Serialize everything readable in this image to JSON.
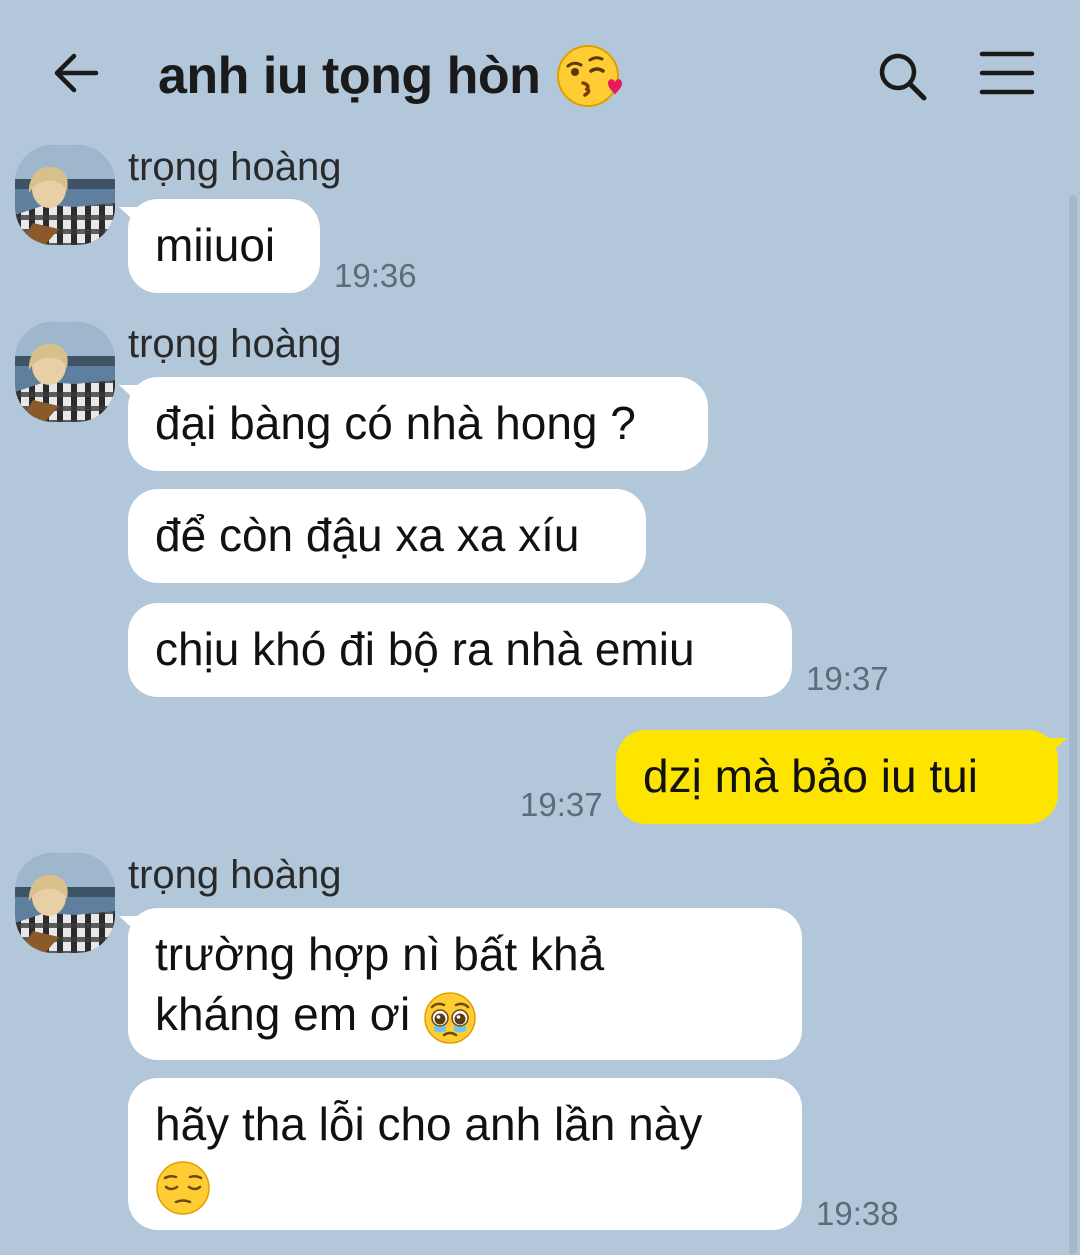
{
  "header": {
    "title": "anh iu tọng hòn",
    "title_emoji_icon": "face-blowing-kiss-icon",
    "back_icon": "arrow-left-icon",
    "search_icon": "search-icon",
    "menu_icon": "hamburger-menu-icon"
  },
  "colors": {
    "background": "#b2c7d9",
    "incoming_bubble": "#ffffff",
    "outgoing_bubble": "#fee500",
    "timestamp": "#5d6c79"
  },
  "messages": [
    {
      "sender": "trọng hoàng",
      "text": "miiuoi",
      "time": "19:36"
    },
    {
      "sender": "trọng hoàng",
      "text": "đại bàng có nhà hong ?"
    },
    {
      "text": "để còn đậu xa xa xíu"
    },
    {
      "text": "chịu khó đi bộ ra nhà emiu",
      "time": "19:37"
    },
    {
      "outgoing": true,
      "text": "dzị mà bảo iu tui",
      "time": "19:37"
    },
    {
      "sender": "trọng hoàng",
      "text_line1": "trường hợp nì bất khả",
      "text_line2": "kháng em ơi",
      "emoji_icon": "pleading-face-icon"
    },
    {
      "text_line1": "hãy tha lỗi cho anh lần này",
      "emoji_icon": "pensive-face-icon",
      "time": "19:38"
    }
  ]
}
